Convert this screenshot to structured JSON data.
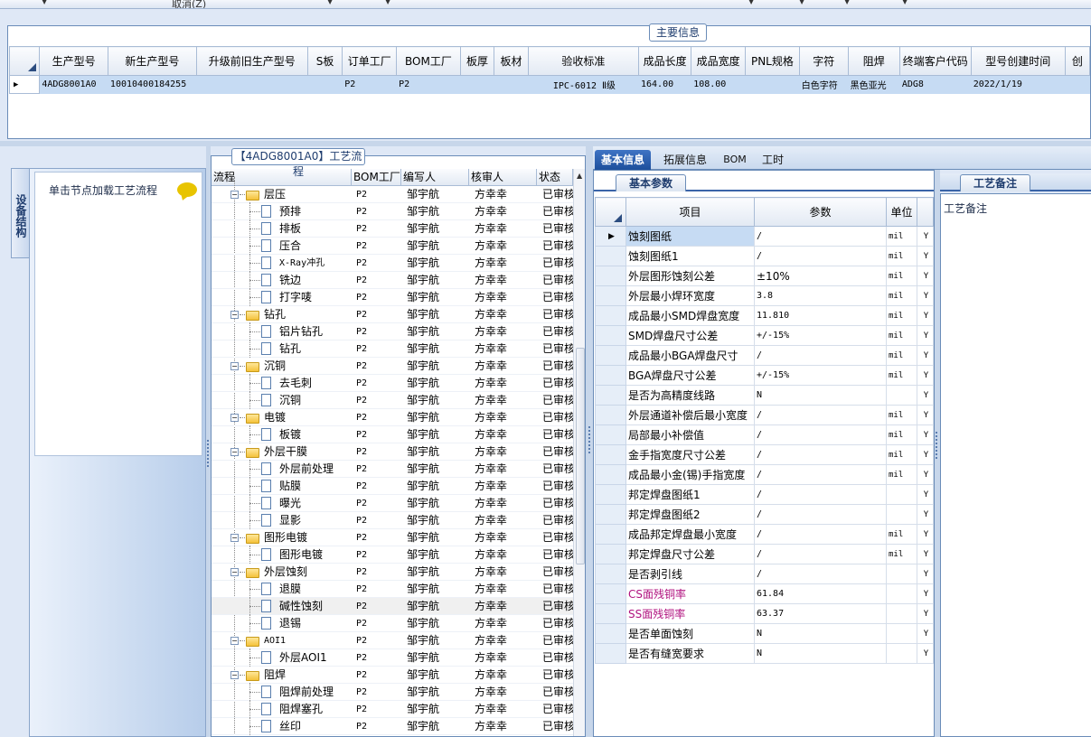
{
  "toolbar": {
    "cancel_label": "取消(Z)"
  },
  "main_info": {
    "legend": "主要信息",
    "columns": [
      "生产型号",
      "新生产型号",
      "升级前旧生产型号",
      "S板",
      "订单工厂",
      "BOM工厂",
      "板厚",
      "板材",
      "验收标准",
      "成品长度",
      "成品宽度",
      "PNL规格",
      "字符",
      "阻焊",
      "终端客户代码",
      "型号创建时间",
      "创"
    ],
    "row": [
      "4ADG8001A0",
      "10010400184255",
      "",
      "",
      "P2",
      "P2",
      "",
      "",
      "IPC-6012 Ⅱ级",
      "164.00",
      "108.00",
      "",
      "白色字符",
      "黑色亚光",
      "ADG8",
      "2022/1/19",
      ""
    ]
  },
  "left_panel": {
    "vertical_tab": "设备结构",
    "tip": "单击节点加载工艺流程"
  },
  "flow": {
    "legend": "【4ADG8001A0】工艺流程",
    "columns": [
      "流程",
      "BOM工厂",
      "编写人",
      "核审人",
      "状态"
    ],
    "rows": [
      {
        "name": "层压",
        "level": 0,
        "bom": "P2",
        "writer": "邹宇航",
        "reviewer": "方幸幸",
        "status": "已审核"
      },
      {
        "name": "预排",
        "level": 1,
        "bom": "P2",
        "writer": "邹宇航",
        "reviewer": "方幸幸",
        "status": "已审核"
      },
      {
        "name": "排板",
        "level": 1,
        "bom": "P2",
        "writer": "邹宇航",
        "reviewer": "方幸幸",
        "status": "已审核"
      },
      {
        "name": "压合",
        "level": 1,
        "bom": "P2",
        "writer": "邹宇航",
        "reviewer": "方幸幸",
        "status": "已审核"
      },
      {
        "name": "X-Ray冲孔",
        "level": 1,
        "bom": "P2",
        "writer": "邹宇航",
        "reviewer": "方幸幸",
        "status": "已审核"
      },
      {
        "name": "铣边",
        "level": 1,
        "bom": "P2",
        "writer": "邹宇航",
        "reviewer": "方幸幸",
        "status": "已审核"
      },
      {
        "name": "打字唛",
        "level": 1,
        "bom": "P2",
        "writer": "邹宇航",
        "reviewer": "方幸幸",
        "status": "已审核"
      },
      {
        "name": "钻孔",
        "level": 0,
        "bom": "P2",
        "writer": "邹宇航",
        "reviewer": "方幸幸",
        "status": "已审核"
      },
      {
        "name": "铝片钻孔",
        "level": 1,
        "bom": "P2",
        "writer": "邹宇航",
        "reviewer": "方幸幸",
        "status": "已审核"
      },
      {
        "name": "钻孔",
        "level": 1,
        "bom": "P2",
        "writer": "邹宇航",
        "reviewer": "方幸幸",
        "status": "已审核"
      },
      {
        "name": "沉铜",
        "level": 0,
        "bom": "P2",
        "writer": "邹宇航",
        "reviewer": "方幸幸",
        "status": "已审核"
      },
      {
        "name": "去毛刺",
        "level": 1,
        "bom": "P2",
        "writer": "邹宇航",
        "reviewer": "方幸幸",
        "status": "已审核"
      },
      {
        "name": "沉铜",
        "level": 1,
        "bom": "P2",
        "writer": "邹宇航",
        "reviewer": "方幸幸",
        "status": "已审核"
      },
      {
        "name": "电镀",
        "level": 0,
        "bom": "P2",
        "writer": "邹宇航",
        "reviewer": "方幸幸",
        "status": "已审核"
      },
      {
        "name": "板镀",
        "level": 1,
        "bom": "P2",
        "writer": "邹宇航",
        "reviewer": "方幸幸",
        "status": "已审核"
      },
      {
        "name": "外层干膜",
        "level": 0,
        "bom": "P2",
        "writer": "邹宇航",
        "reviewer": "方幸幸",
        "status": "已审核"
      },
      {
        "name": "外层前处理",
        "level": 1,
        "bom": "P2",
        "writer": "邹宇航",
        "reviewer": "方幸幸",
        "status": "已审核"
      },
      {
        "name": "贴膜",
        "level": 1,
        "bom": "P2",
        "writer": "邹宇航",
        "reviewer": "方幸幸",
        "status": "已审核"
      },
      {
        "name": "曝光",
        "level": 1,
        "bom": "P2",
        "writer": "邹宇航",
        "reviewer": "方幸幸",
        "status": "已审核"
      },
      {
        "name": "显影",
        "level": 1,
        "bom": "P2",
        "writer": "邹宇航",
        "reviewer": "方幸幸",
        "status": "已审核"
      },
      {
        "name": "图形电镀",
        "level": 0,
        "bom": "P2",
        "writer": "邹宇航",
        "reviewer": "方幸幸",
        "status": "已审核"
      },
      {
        "name": "图形电镀",
        "level": 1,
        "bom": "P2",
        "writer": "邹宇航",
        "reviewer": "方幸幸",
        "status": "已审核"
      },
      {
        "name": "外层蚀刻",
        "level": 0,
        "bom": "P2",
        "writer": "邹宇航",
        "reviewer": "方幸幸",
        "status": "已审核"
      },
      {
        "name": "退膜",
        "level": 1,
        "bom": "P2",
        "writer": "邹宇航",
        "reviewer": "方幸幸",
        "status": "已审核"
      },
      {
        "name": "碱性蚀刻",
        "level": 1,
        "bom": "P2",
        "writer": "邹宇航",
        "reviewer": "方幸幸",
        "status": "已审核",
        "highlight": true
      },
      {
        "name": "退锡",
        "level": 1,
        "bom": "P2",
        "writer": "邹宇航",
        "reviewer": "方幸幸",
        "status": "已审核"
      },
      {
        "name": "AOI1",
        "level": 0,
        "bom": "P2",
        "writer": "邹宇航",
        "reviewer": "方幸幸",
        "status": "已审核"
      },
      {
        "name": "外层AOI1",
        "level": 1,
        "bom": "P2",
        "writer": "邹宇航",
        "reviewer": "方幸幸",
        "status": "已审核"
      },
      {
        "name": "阻焊",
        "level": 0,
        "bom": "P2",
        "writer": "邹宇航",
        "reviewer": "方幸幸",
        "status": "已审核"
      },
      {
        "name": "阻焊前处理",
        "level": 1,
        "bom": "P2",
        "writer": "邹宇航",
        "reviewer": "方幸幸",
        "status": "已审核"
      },
      {
        "name": "阻焊塞孔",
        "level": 1,
        "bom": "P2",
        "writer": "邹宇航",
        "reviewer": "方幸幸",
        "status": "已审核"
      },
      {
        "name": "丝印",
        "level": 1,
        "bom": "P2",
        "writer": "邹宇航",
        "reviewer": "方幸幸",
        "status": "已审核"
      }
    ]
  },
  "tabs": [
    "基本信息",
    "拓展信息",
    "BOM",
    "工时"
  ],
  "basic_params": {
    "subtab": "基本参数",
    "columns": [
      "项目",
      "参数",
      "单位"
    ],
    "rows": [
      {
        "item": "蚀刻图纸",
        "value": "/",
        "unit": "mil",
        "flag": "Y",
        "selected": true
      },
      {
        "item": "蚀刻图纸1",
        "value": "/",
        "unit": "mil",
        "flag": "Y"
      },
      {
        "item": "外层图形蚀刻公差",
        "value": "±10%",
        "unit": "mil",
        "flag": "Y"
      },
      {
        "item": "外层最小焊环宽度",
        "value": "3.8",
        "unit": "mil",
        "flag": "Y"
      },
      {
        "item": "成品最小SMD焊盘宽度",
        "value": "11.810",
        "unit": "mil",
        "flag": "Y"
      },
      {
        "item": "SMD焊盘尺寸公差",
        "value": "+/-15%",
        "unit": "mil",
        "flag": "Y"
      },
      {
        "item": "成品最小BGA焊盘尺寸",
        "value": "/",
        "unit": "mil",
        "flag": "Y"
      },
      {
        "item": "BGA焊盘尺寸公差",
        "value": "+/-15%",
        "unit": "mil",
        "flag": "Y"
      },
      {
        "item": "是否为高精度线路",
        "value": "N",
        "unit": "",
        "flag": "Y"
      },
      {
        "item": "外层通道补偿后最小宽度",
        "value": "/",
        "unit": "mil",
        "flag": "Y"
      },
      {
        "item": "局部最小补偿值",
        "value": "/",
        "unit": "mil",
        "flag": "Y"
      },
      {
        "item": "金手指宽度尺寸公差",
        "value": "/",
        "unit": "mil",
        "flag": "Y"
      },
      {
        "item": "成品最小金(锡)手指宽度",
        "value": "/",
        "unit": "mil",
        "flag": "Y"
      },
      {
        "item": "邦定焊盘图纸1",
        "value": "/",
        "unit": "",
        "flag": "Y"
      },
      {
        "item": "邦定焊盘图纸2",
        "value": "/",
        "unit": "",
        "flag": "Y"
      },
      {
        "item": "成品邦定焊盘最小宽度",
        "value": "/",
        "unit": "mil",
        "flag": "Y"
      },
      {
        "item": "邦定焊盘尺寸公差",
        "value": "/",
        "unit": "mil",
        "flag": "Y"
      },
      {
        "item": "是否剥引线",
        "value": "/",
        "unit": "",
        "flag": "Y"
      },
      {
        "item": "CS面残铜率",
        "value": "61.84",
        "unit": "",
        "flag": "Y",
        "magenta": true
      },
      {
        "item": "SS面残铜率",
        "value": "63.37",
        "unit": "",
        "flag": "Y",
        "magenta": true
      },
      {
        "item": "是否单面蚀刻",
        "value": "N",
        "unit": "",
        "flag": "Y"
      },
      {
        "item": "是否有缝宽要求",
        "value": "N",
        "unit": "",
        "flag": "Y"
      }
    ]
  },
  "notes": {
    "tab": "工艺备注",
    "label": "工艺备注"
  },
  "colors": {
    "accent": "#1d4f9c",
    "selection": "#c6dbf3",
    "border": "#6a8cb8",
    "magenta": "#b0127f",
    "folder": "#f4c23a"
  }
}
